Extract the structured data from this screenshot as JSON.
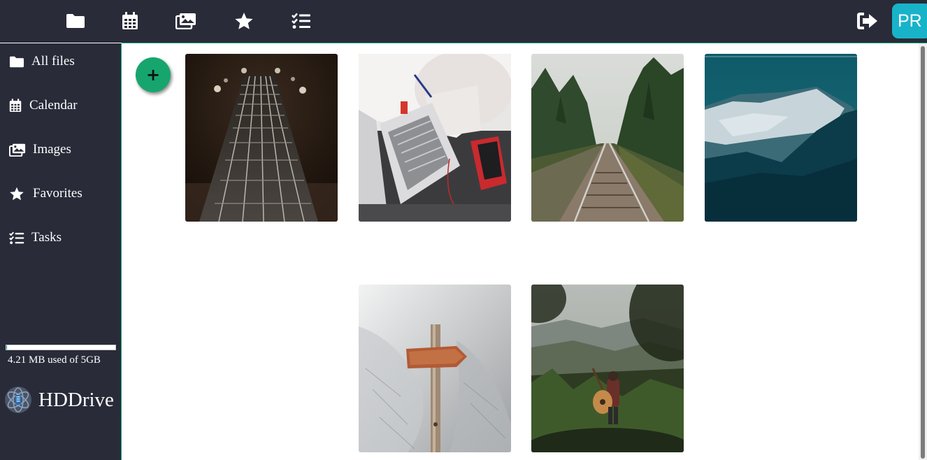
{
  "topbar": {
    "icons": [
      "folder-icon",
      "calendar-icon",
      "images-icon",
      "star-icon",
      "tasks-icon"
    ],
    "logout_icon": "logout-icon",
    "avatar_initials": "PR",
    "colors": {
      "background": "#292b39",
      "accent": "#1aa777",
      "avatar": "#18b3c9"
    }
  },
  "sidebar": {
    "items": [
      {
        "label": "All files",
        "icon": "folder-icon"
      },
      {
        "label": "Calendar",
        "icon": "calendar-icon"
      },
      {
        "label": "Images",
        "icon": "images-icon"
      },
      {
        "label": "Favorites",
        "icon": "star-icon"
      },
      {
        "label": "Tasks",
        "icon": "tasks-icon"
      }
    ],
    "storage": {
      "used_text": "4.21 MB used of 5GB",
      "fraction_used": 0.001
    },
    "brand": {
      "name": "HDDrive",
      "logo_icon": "hddrive-logo-icon"
    }
  },
  "content": {
    "add_button_label": "+",
    "images": [
      {
        "subject": "guitar-neck-photo"
      },
      {
        "subject": "laptop-desk-photo"
      },
      {
        "subject": "railway-forest-photo"
      },
      {
        "subject": "mountain-range-photo"
      },
      {
        "subject": "signpost-snow-photo"
      },
      {
        "subject": "guitarist-valley-photo"
      }
    ]
  }
}
